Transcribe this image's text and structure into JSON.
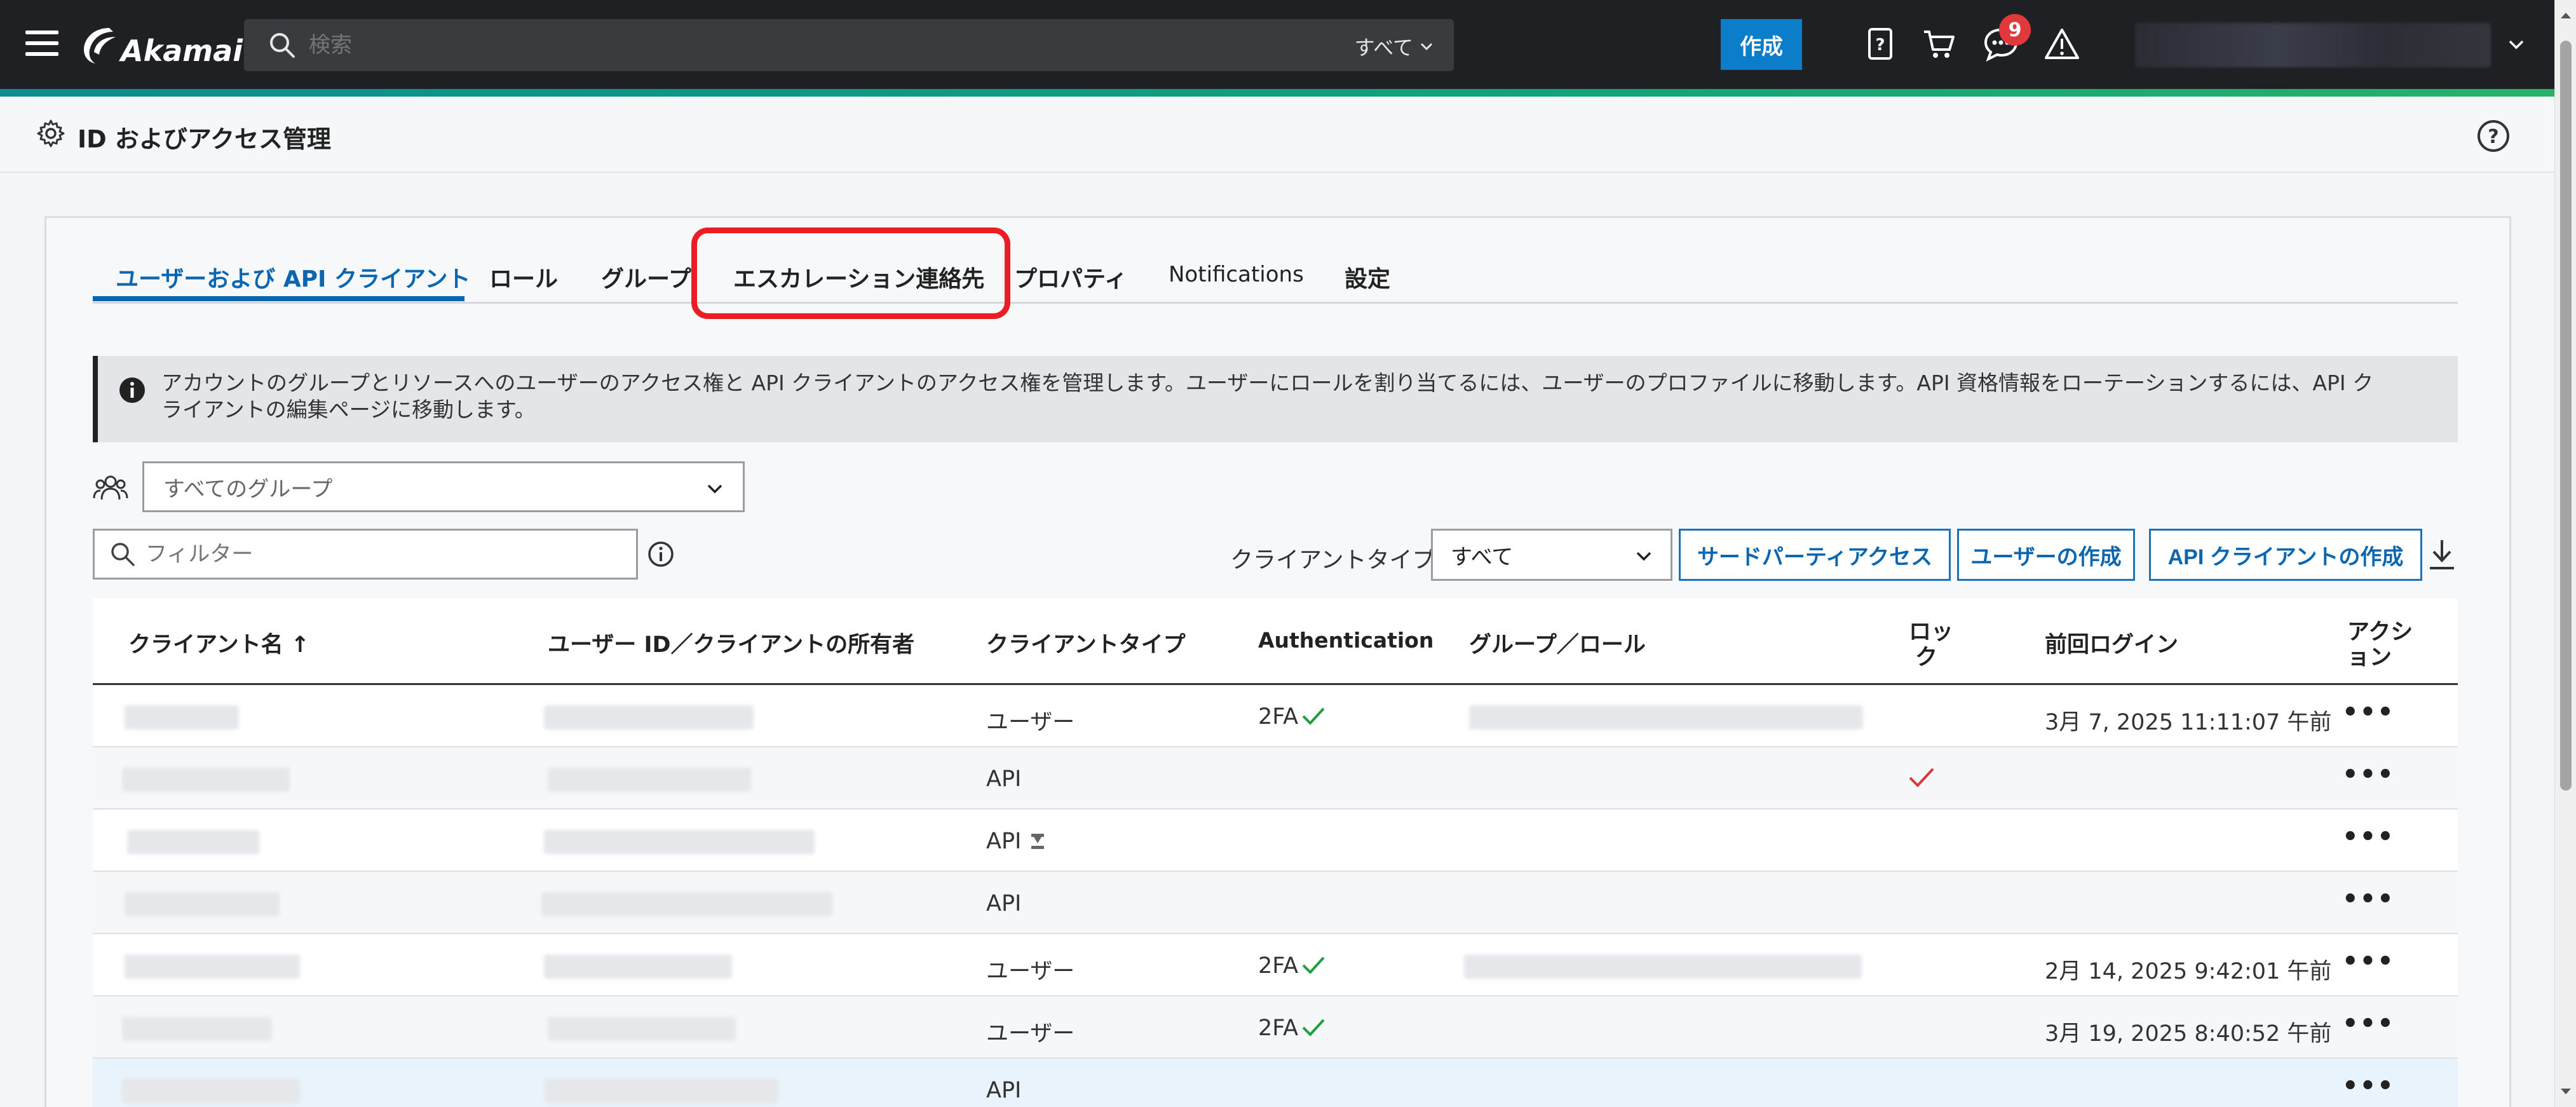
{
  "topbar": {
    "brand": "Akamai",
    "search_placeholder": "検索",
    "search_scope": "すべて",
    "create_label": "作成",
    "notifications_count": "9"
  },
  "page": {
    "title": "ID およびアクセス管理"
  },
  "tabs": [
    {
      "label": "ユーザーおよび API クライアント",
      "active": true
    },
    {
      "label": "ロール"
    },
    {
      "label": "グループ"
    },
    {
      "label": "エスカレーション連絡先",
      "highlighted": true
    },
    {
      "label": "プロパティ"
    },
    {
      "label": "Notifications"
    },
    {
      "label": "設定"
    }
  ],
  "info": {
    "line1": "アカウントのグループとリソースへのユーザーのアクセス権と API クライアントのアクセス権を管理します。ユーザーにロールを割り当てるには、ユーザーのプロファイルに移動します。API 資格情報をローテーションするには、API ク",
    "line2": "ライアントの編集ページに移動します。"
  },
  "controls": {
    "group_select": "すべてのグループ",
    "filter_placeholder": "フィルター",
    "client_type_label": "クライアントタイプ",
    "client_type_value": "すべて",
    "third_party_button": "サードパーティアクセス",
    "create_user_button": "ユーザーの作成",
    "create_api_client_button": "API クライアントの作成"
  },
  "table": {
    "headers": {
      "client_name": "クライアント名 ↑",
      "owner": "ユーザー ID／クライアントの所有者",
      "client_type": "クライアントタイプ",
      "auth": "Authentication",
      "group_role": "グループ／ロール",
      "lock_1": "ロッ",
      "lock_2": "ク",
      "last_login": "前回ログイン",
      "action_1": "アクシ",
      "action_2": "ョン"
    },
    "rows": [
      {
        "type": "ユーザー",
        "auth": "2FA",
        "last_login": "3月 7, 2025 11:11:07 午前",
        "actions": "•••"
      },
      {
        "type": "API",
        "auth": "",
        "last_login": "",
        "actions": "•••",
        "locked": true
      },
      {
        "type": "API",
        "auth": "",
        "last_login": "",
        "actions": "•••",
        "cert": true
      },
      {
        "type": "API",
        "auth": "",
        "last_login": "",
        "actions": "•••"
      },
      {
        "type": "ユーザー",
        "auth": "2FA",
        "last_login": "2月 14, 2025 9:42:01 午前",
        "actions": "•••"
      },
      {
        "type": "ユーザー",
        "auth": "2FA",
        "last_login": "3月 19, 2025 8:40:52 午前",
        "actions": "•••"
      },
      {
        "type": "API",
        "auth": "",
        "last_login": "",
        "actions": "•••"
      }
    ]
  },
  "colors": {
    "accent": "#0b66b0",
    "highlight": "#ea1c24",
    "success": "#1e9e3e",
    "danger": "#d9363e"
  }
}
